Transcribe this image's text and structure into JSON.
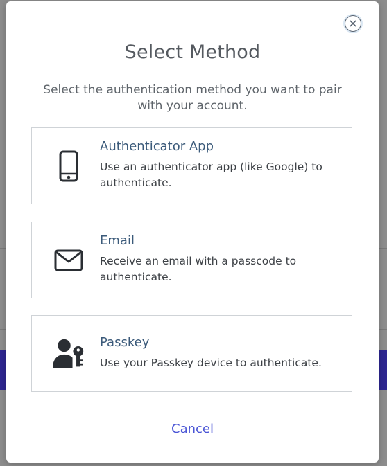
{
  "modal": {
    "title": "Select Method",
    "subtitle": "Select the authentication method you want to pair with your account.",
    "close_icon": "close-icon",
    "cancel_label": "Cancel"
  },
  "options": [
    {
      "title": "Authenticator App",
      "description": "Use an authenticator app (like Google) to authenticate.",
      "icon": "smartphone-icon"
    },
    {
      "title": "Email",
      "description": "Receive an email with a passcode to authenticate.",
      "icon": "envelope-icon"
    },
    {
      "title": "Passkey",
      "description": "Use your Passkey device to authenticate.",
      "icon": "user-key-icon"
    }
  ],
  "colors": {
    "accent": "#4b56d6",
    "option_title": "#3b5a7a",
    "backdrop_band": "#2d2690"
  }
}
